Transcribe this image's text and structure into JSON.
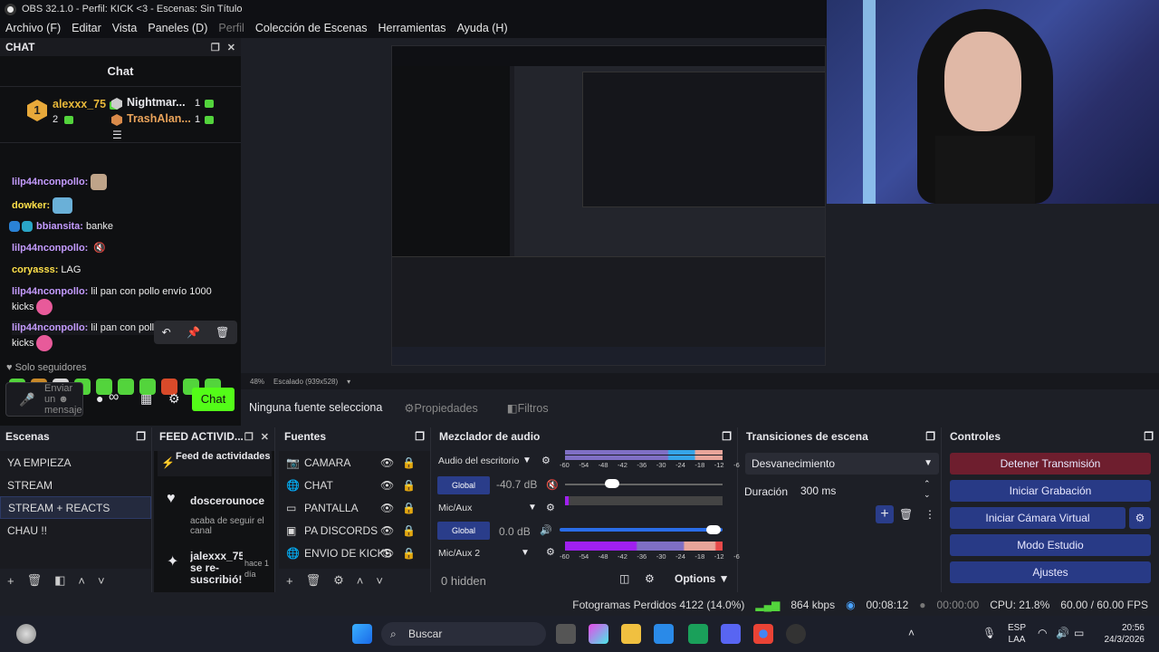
{
  "window": {
    "title": "OBS 32.1.0 - Perfil: KICK <3 - Escenas: Sin Título"
  },
  "menu": [
    "Archivo (F)",
    "Editar",
    "Vista",
    "Paneles (D)",
    "Perfil",
    "Colección de Escenas",
    "Herramientas",
    "Ayuda (H)"
  ],
  "chat": {
    "dock_title": "CHAT",
    "panel_title": "Chat",
    "leaders": [
      {
        "rank": "1",
        "name": "alexxx_75",
        "count": "2"
      },
      {
        "name": "Nightmar...",
        "count": "1"
      },
      {
        "name": "TrashAlan...",
        "count": "1"
      }
    ],
    "messages": [
      {
        "user": "lilp44nconpollo:",
        "text": ""
      },
      {
        "user": "dowker:",
        "text": ""
      },
      {
        "user": "bbiansita:",
        "text": " banke"
      },
      {
        "user": "lilp44nconpollo:",
        "text": ""
      },
      {
        "user": "coryasss:",
        "text": " LAG"
      },
      {
        "user": "lilp44nconpollo:",
        "text": " lil pan con pollo envío 1000"
      },
      {
        "user": "",
        "text": "kicks"
      },
      {
        "user": "lilp44nconpollo:",
        "text": " lil pan con pollo"
      },
      {
        "user": "",
        "text": "kicks"
      }
    ],
    "followers_only": "Solo seguidores",
    "send_placeholder_1": "Enviar",
    "send_placeholder_2": "un",
    "send_placeholder_3": "mensaje",
    "chat_button": "Chat",
    "infinity": "∞"
  },
  "preview": {
    "zoom": "48%",
    "scaling": "Escalado (939x528)"
  },
  "properties_bar": {
    "no_source": "Ninguna fuente selecciona",
    "properties": "Propiedades",
    "filters": "Filtros"
  },
  "scenes": {
    "title": "Escenas",
    "items": [
      "YA EMPIEZA",
      "STREAM",
      "STREAM + REACTS",
      "CHAU !!"
    ],
    "selected": "STREAM + REACTS"
  },
  "feed": {
    "title": "FEED ACTIVID...",
    "header": "Feed de actividades",
    "entries": [
      {
        "name": "doscerounoce",
        "detail": "acaba de seguir el canal"
      },
      {
        "name": "jalexxx_75 se re-suscribió!",
        "detail": "hace 1 día"
      }
    ]
  },
  "sources": {
    "title": "Fuentes",
    "items": [
      "CAMARA",
      "CHAT",
      "PANTALLA",
      "PA DISCORDS",
      "ENVIO DE KICKS"
    ]
  },
  "mixer": {
    "title": "Mezclador de audio",
    "channels": [
      {
        "name": "Audio del escritorio",
        "db": "-40.7 dB",
        "label": "Global"
      },
      {
        "name": "Mic/Aux",
        "db": "0.0 dB",
        "label": "Global"
      },
      {
        "name": "Mic/Aux 2"
      }
    ],
    "ticks": [
      "-60",
      "-54",
      "-48",
      "-42",
      "-36",
      "-30",
      "-24",
      "-18",
      "-12",
      "-6",
      "0"
    ],
    "hidden": "0 hidden",
    "options": "Options"
  },
  "transitions": {
    "title": "Transiciones de escena",
    "type": "Desvanecimiento",
    "duration_label": "Duración",
    "duration": "300 ms"
  },
  "controls": {
    "title": "Controles",
    "buttons": [
      "Detener Transmisión",
      "Iniciar Grabación",
      "Iniciar Cámara Virtual",
      "Modo Estudio",
      "Ajustes"
    ]
  },
  "status": {
    "dropped": "Fotogramas Perdidos 4122 (14.0%)",
    "kbps": "864 kbps",
    "stream_time": "00:08:12",
    "rec_time": "00:00:00",
    "cpu": "CPU: 21.8%",
    "fps": "60.00 / 60.00 FPS"
  },
  "taskbar": {
    "search": "Buscar",
    "lang": "ESP",
    "region": "LAA",
    "time": "20:56",
    "date": "24/3/2026"
  },
  "colors": {
    "kick_green": "#53fc18",
    "stop_button": "#6e1e2e",
    "control_button": "#283a86"
  }
}
